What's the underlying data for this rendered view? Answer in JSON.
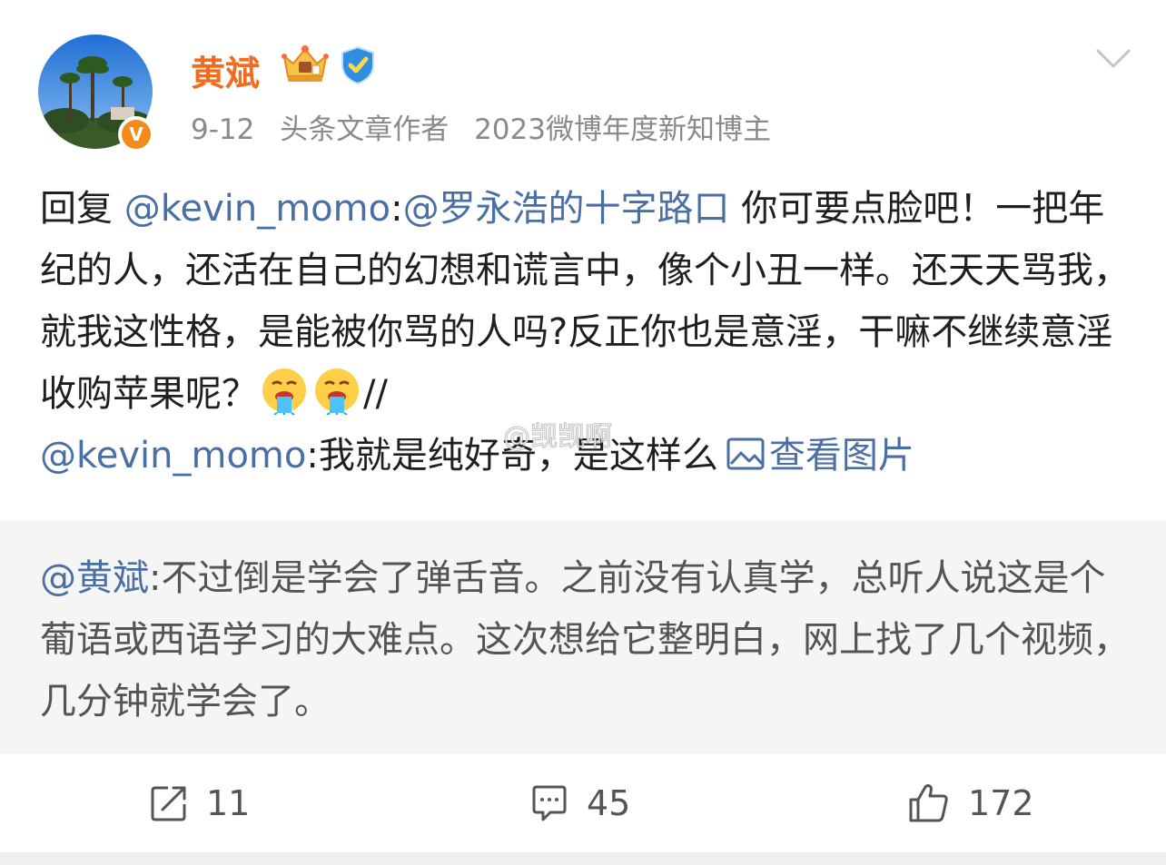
{
  "post": {
    "author": "黄斌",
    "date": "9-12",
    "tags": [
      "头条文章作者",
      "2023微博年度新知博主"
    ],
    "badges": [
      "crown-badge-icon",
      "verified-shield-icon"
    ],
    "verify_mark": "V",
    "body": {
      "reply_prefix": "回复",
      "reply_to": "@kevin_momo",
      "colon1": ":",
      "mention": "@罗永浩的十字路口",
      "text1": " 你可要点脸吧！一把年纪的人，还活在自己的幻想和谎言中，像个小丑一样。还天天骂我，就我这性格，是能被你骂的人吗?反正你也是意淫，干嘛不继续意淫收购苹果呢？",
      "emoji": "vomit-face-icon",
      "separator": "//",
      "quoted_user": "@kevin_momo",
      "text2": ":我就是纯好奇，是这样么",
      "view_image_label": "查看图片"
    },
    "watermark": "@觊觊啊"
  },
  "quote": {
    "user": "@黄斌",
    "text": ":不过倒是学会了弹舌音。之前没有认真学，总听人说这是个葡语或西语学习的大难点。这次想给它整明白，网上找了几个视频，几分钟就学会了。"
  },
  "actions": {
    "repost_count": "11",
    "comment_count": "45",
    "like_count": "172"
  },
  "colors": {
    "username": "#f06d1f",
    "link": "#4a6fa5",
    "quote_bg": "#f5f5f5"
  }
}
